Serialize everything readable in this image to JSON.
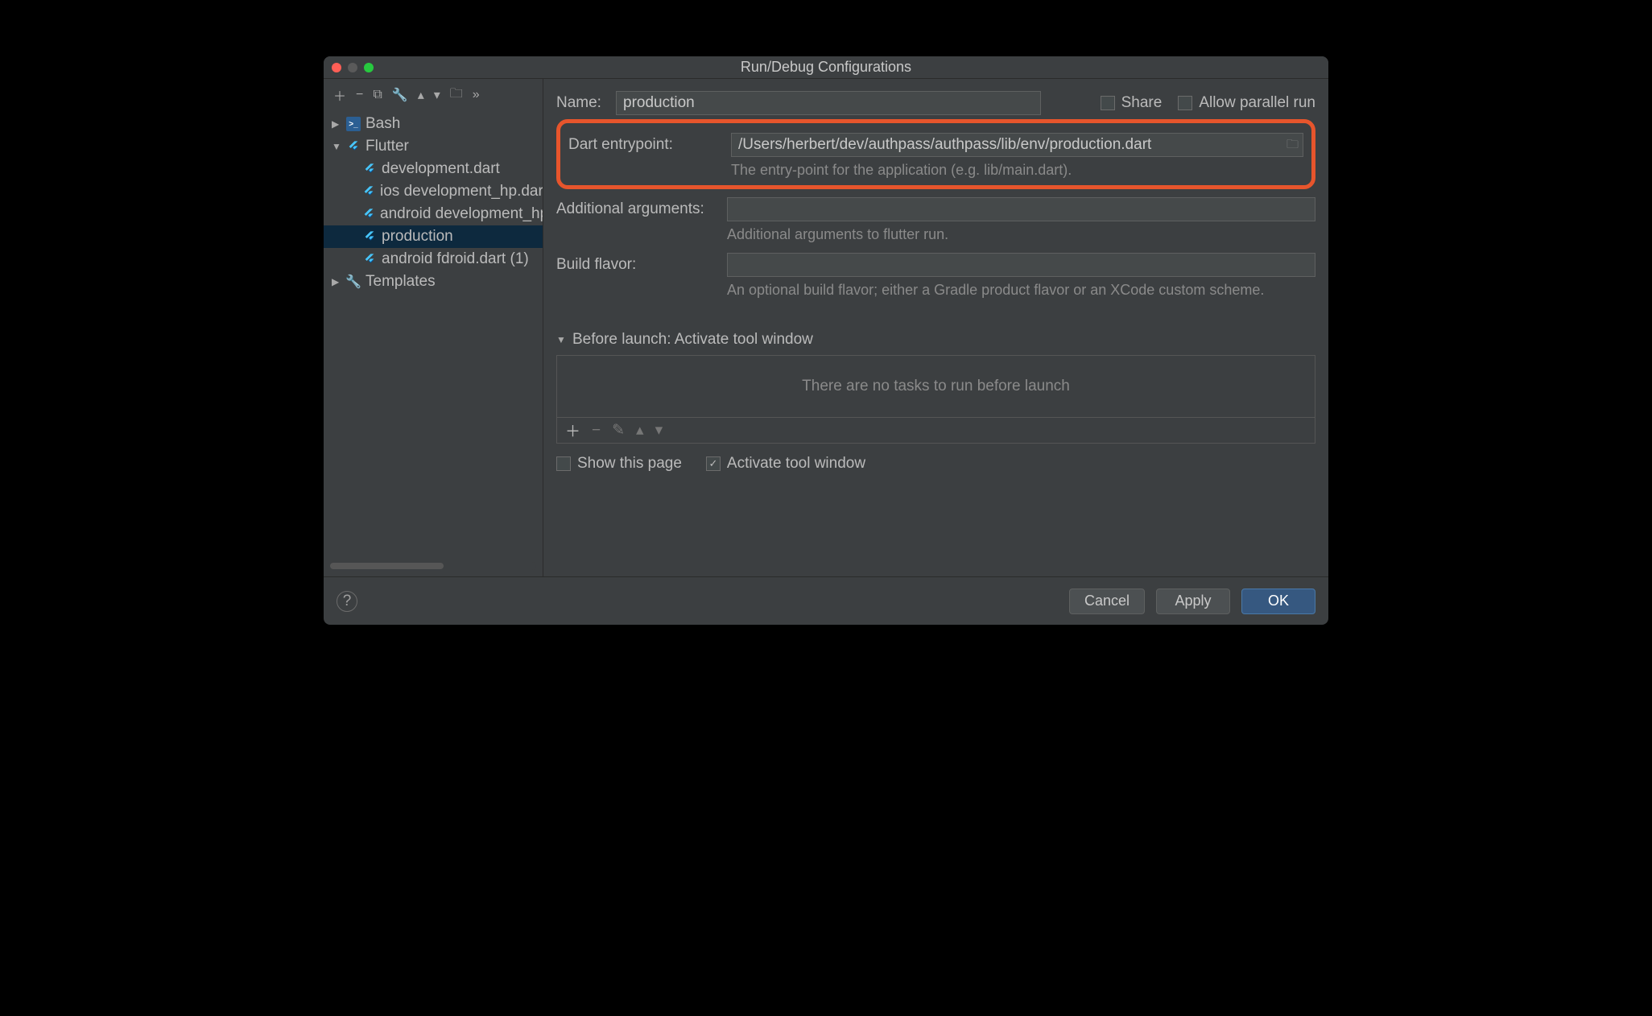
{
  "window": {
    "title": "Run/Debug Configurations"
  },
  "sidebar": {
    "items": [
      {
        "label": "Bash",
        "type": "bash",
        "expanded": false,
        "level": 1
      },
      {
        "label": "Flutter",
        "type": "flutter",
        "expanded": true,
        "level": 1
      },
      {
        "label": "development.dart",
        "type": "flutter",
        "level": 2
      },
      {
        "label": "ios development_hp.dart",
        "type": "flutter",
        "level": 2
      },
      {
        "label": "android development_hp.dart",
        "type": "flutter",
        "level": 2
      },
      {
        "label": "production",
        "type": "flutter",
        "level": 2,
        "selected": true
      },
      {
        "label": "android fdroid.dart (1)",
        "type": "flutter",
        "level": 2
      },
      {
        "label": "Templates",
        "type": "templates",
        "expanded": false,
        "level": 1
      }
    ]
  },
  "form": {
    "name_label": "Name:",
    "name_value": "production",
    "share_label": "Share",
    "share_checked": false,
    "parallel_label": "Allow parallel run",
    "parallel_checked": false,
    "entrypoint_label": "Dart entrypoint:",
    "entrypoint_value": "/Users/herbert/dev/authpass/authpass/lib/env/production.dart",
    "entrypoint_hint": "The entry-point for the application (e.g. lib/main.dart).",
    "args_label": "Additional arguments:",
    "args_value": "",
    "args_hint": "Additional arguments to flutter run.",
    "flavor_label": "Build flavor:",
    "flavor_value": "",
    "flavor_hint": "An optional build flavor; either a Gradle product flavor or an XCode custom scheme."
  },
  "before_launch": {
    "header": "Before launch: Activate tool window",
    "empty_text": "There are no tasks to run before launch",
    "show_page_label": "Show this page",
    "show_page_checked": false,
    "activate_label": "Activate tool window",
    "activate_checked": true
  },
  "footer": {
    "cancel": "Cancel",
    "apply": "Apply",
    "ok": "OK"
  }
}
